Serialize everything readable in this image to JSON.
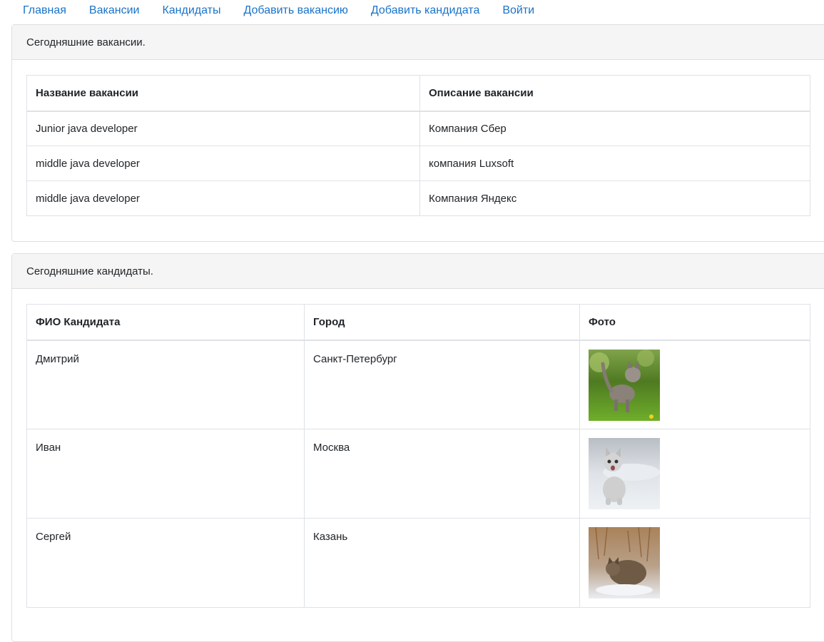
{
  "nav": {
    "items": [
      "Главная",
      "Вакансии",
      "Кандидаты",
      "Добавить вакансию",
      "Добавить кандидата",
      "Войти"
    ]
  },
  "vacancies": {
    "header": "Сегодняшние вакансии.",
    "columns": [
      "Название вакансии",
      "Описание вакансии"
    ],
    "rows": [
      {
        "name": "Junior java developer",
        "description": "Компания Сбер"
      },
      {
        "name": "middle java developer",
        "description": "компания Luxsoft"
      },
      {
        "name": "middle java developer",
        "description": "Компания Яндекс"
      }
    ]
  },
  "candidates": {
    "header": "Сегодняшние кандидаты.",
    "columns": [
      "ФИО Кандидата",
      "Город",
      "Фото"
    ],
    "rows": [
      {
        "name": "Дмитрий",
        "city": "Санкт-Петербург",
        "photo": "kitten-on-grass-photo"
      },
      {
        "name": "Иван",
        "city": "Москва",
        "photo": "white-kitten-photo"
      },
      {
        "name": "Сергей",
        "city": "Казань",
        "photo": "cat-in-snow-photo"
      }
    ]
  }
}
